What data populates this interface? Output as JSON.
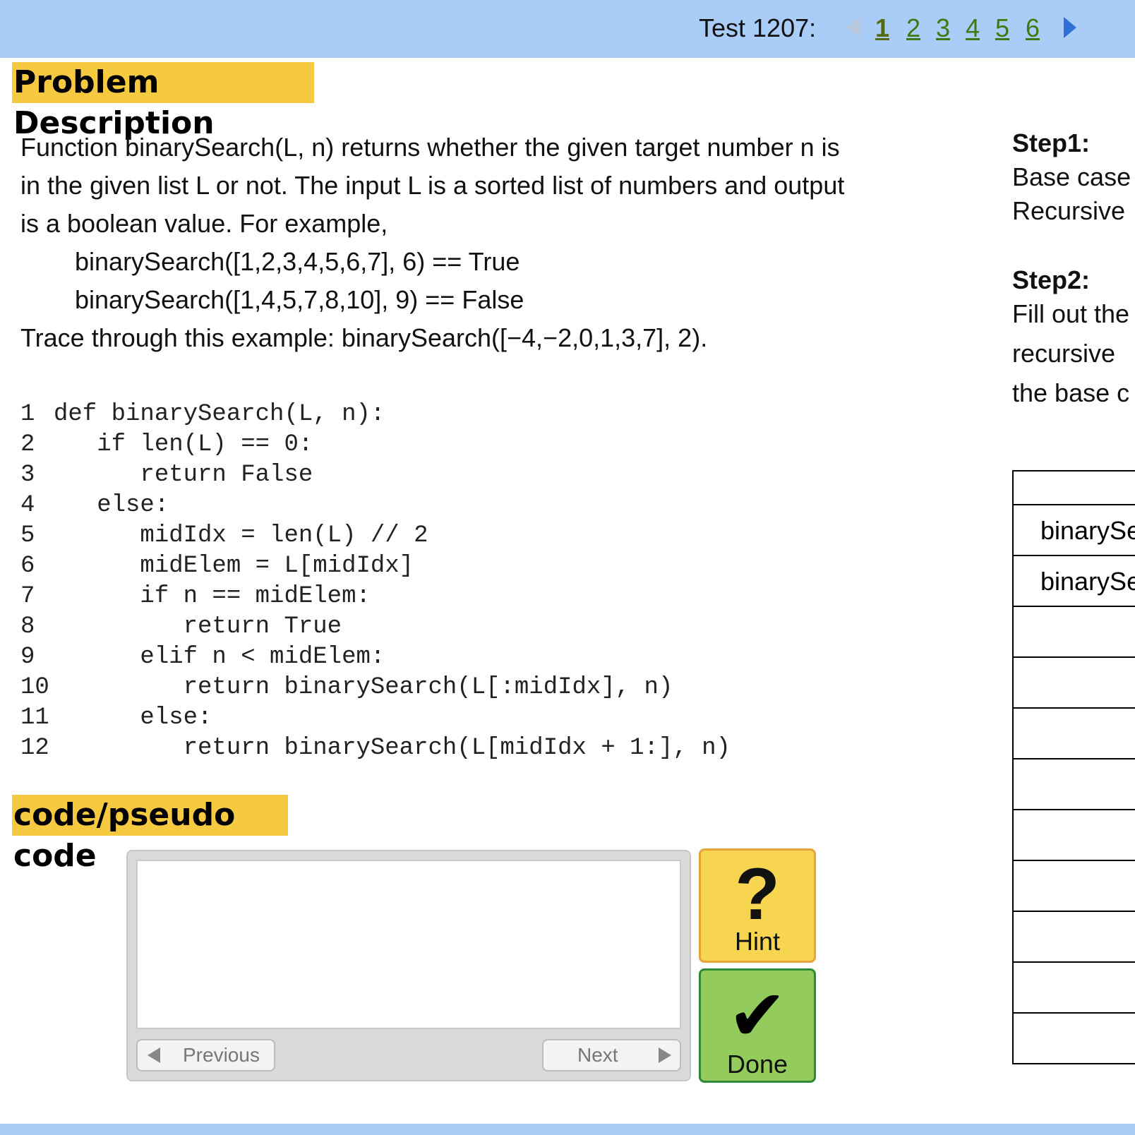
{
  "header": {
    "test_label": "Test 1207:",
    "pages": [
      "1",
      "2",
      "3",
      "4",
      "5",
      "6"
    ],
    "current_page": "1"
  },
  "sections": {
    "problem_title": "Problem Description",
    "code_title": "code/pseudo code"
  },
  "description": {
    "line1": "Function binarySearch(L, n) returns whether the given target number n is",
    "line2": "in the given list L or not. The input L is a sorted list of numbers and output",
    "line3": "is a boolean value. For example,",
    "example1": "binarySearch([1,2,3,4,5,6,7], 6) == True",
    "example2": "binarySearch([1,4,5,7,8,10], 9) == False",
    "trace": "Trace through this example: binarySearch([−4,−2,0,1,3,7], 2)."
  },
  "code_lines": [
    {
      "num": "1",
      "text": "def binarySearch(L, n):"
    },
    {
      "num": "2",
      "text": "   if len(L) == 0:"
    },
    {
      "num": "3",
      "text": "      return False"
    },
    {
      "num": "4",
      "text": "   else:"
    },
    {
      "num": "5",
      "text": "      midIdx = len(L) // 2"
    },
    {
      "num": "6",
      "text": "      midElem = L[midIdx]"
    },
    {
      "num": "7",
      "text": "      if n == midElem:"
    },
    {
      "num": "8",
      "text": "         return True"
    },
    {
      "num": "9",
      "text": "      elif n < midElem:"
    },
    {
      "num": "10",
      "text": "         return binarySearch(L[:midIdx], n)"
    },
    {
      "num": "11",
      "text": "      else:"
    },
    {
      "num": "12",
      "text": "         return binarySearch(L[midIdx + 1:], n)"
    }
  ],
  "editor": {
    "value": "",
    "prev_label": "Previous",
    "next_label": "Next"
  },
  "buttons": {
    "hint_symbol": "?",
    "hint_label": "Hint",
    "done_symbol": "✔",
    "done_label": "Done"
  },
  "steps": {
    "step1_title": "Step1:",
    "step1_line1": "Base case",
    "step1_line2": "Recursive",
    "step2_title": "Step2:",
    "step2_line1": "Fill out the",
    "step2_line2": "recursive",
    "step2_line3": "the base c"
  },
  "trace_table": {
    "rows": [
      "binarySe",
      "binarySe",
      "",
      "",
      "",
      "",
      "",
      "",
      "",
      "",
      ""
    ]
  },
  "colors": {
    "top_bar": "#a9cdf6",
    "section_highlight": "#f5c940",
    "hint_button": "#f7d550",
    "done_button": "#93cc5c",
    "page_link": "#3c7a12"
  }
}
